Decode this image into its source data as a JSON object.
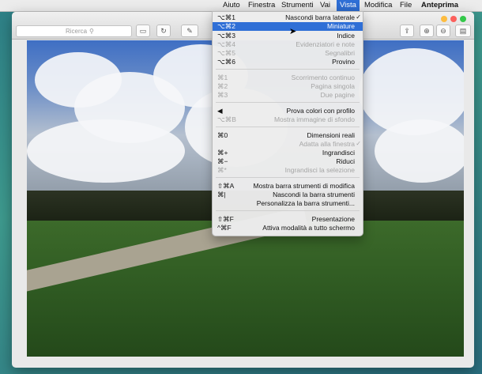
{
  "menubar": {
    "items": [
      {
        "label": "Anteprima",
        "bold": true
      },
      {
        "label": "File"
      },
      {
        "label": "Modifica"
      },
      {
        "label": "Vista",
        "active": true
      },
      {
        "label": "Vai"
      },
      {
        "label": "Strumenti"
      },
      {
        "label": "Finestra"
      },
      {
        "label": "Aiuto"
      }
    ],
    "apple_icon": ""
  },
  "toolbar": {
    "search_placeholder": "Ricerca",
    "buttons": [
      "share-icon",
      "zoom-in-icon",
      "zoom-out-icon",
      "sidebar-icon",
      "markup-icon",
      "rotate-icon",
      "toolbox-icon"
    ]
  },
  "view_menu": {
    "rows": [
      {
        "label": "Nascondi barra laterale",
        "shortcut": "⌥⌘1",
        "checked": true
      },
      {
        "label": "Miniature",
        "shortcut": "⌥⌘2",
        "highlighted": true
      },
      {
        "label": "Indice",
        "shortcut": "⌥⌘3"
      },
      {
        "label": "Evidenziatori e note",
        "shortcut": "⌥⌘4",
        "disabled": true
      },
      {
        "label": "Segnalibri",
        "shortcut": "⌥⌘5",
        "disabled": true
      },
      {
        "label": "Provino",
        "shortcut": "⌥⌘6"
      },
      {
        "label": "Scorrimento continuo",
        "shortcut": "⌘1",
        "disabled": true
      },
      {
        "label": "Pagina singola",
        "shortcut": "⌘2",
        "disabled": true
      },
      {
        "label": "Due pagine",
        "shortcut": "⌘3",
        "disabled": true
      },
      {
        "label": "Prova colori con profilo",
        "shortcut": "◀",
        "disabled": false
      },
      {
        "label": "Mostra immagine di sfondo",
        "shortcut": "⌥⌘B",
        "disabled": true
      },
      {
        "label": "Dimensioni reali",
        "shortcut": "⌘0"
      },
      {
        "label": "Adatta alla finestra",
        "shortcut": "",
        "disabled": true,
        "checked": true
      },
      {
        "label": "Ingrandisci",
        "shortcut": "⌘+"
      },
      {
        "label": "Riduci",
        "shortcut": "⌘−"
      },
      {
        "label": "Ingrandisci la selezione",
        "shortcut": "⌘*",
        "disabled": true
      },
      {
        "label": "Mostra barra strumenti di modifica",
        "shortcut": "⇧⌘A"
      },
      {
        "label": "Nascondi la barra strumenti",
        "shortcut": "⌘|"
      },
      {
        "label": "Personalizza la barra strumenti...",
        "shortcut": ""
      },
      {
        "label": "Presentazione",
        "shortcut": "⇧⌘F"
      },
      {
        "label": "Attiva modalità a tutto schermo",
        "shortcut": "^⌘F"
      }
    ]
  }
}
